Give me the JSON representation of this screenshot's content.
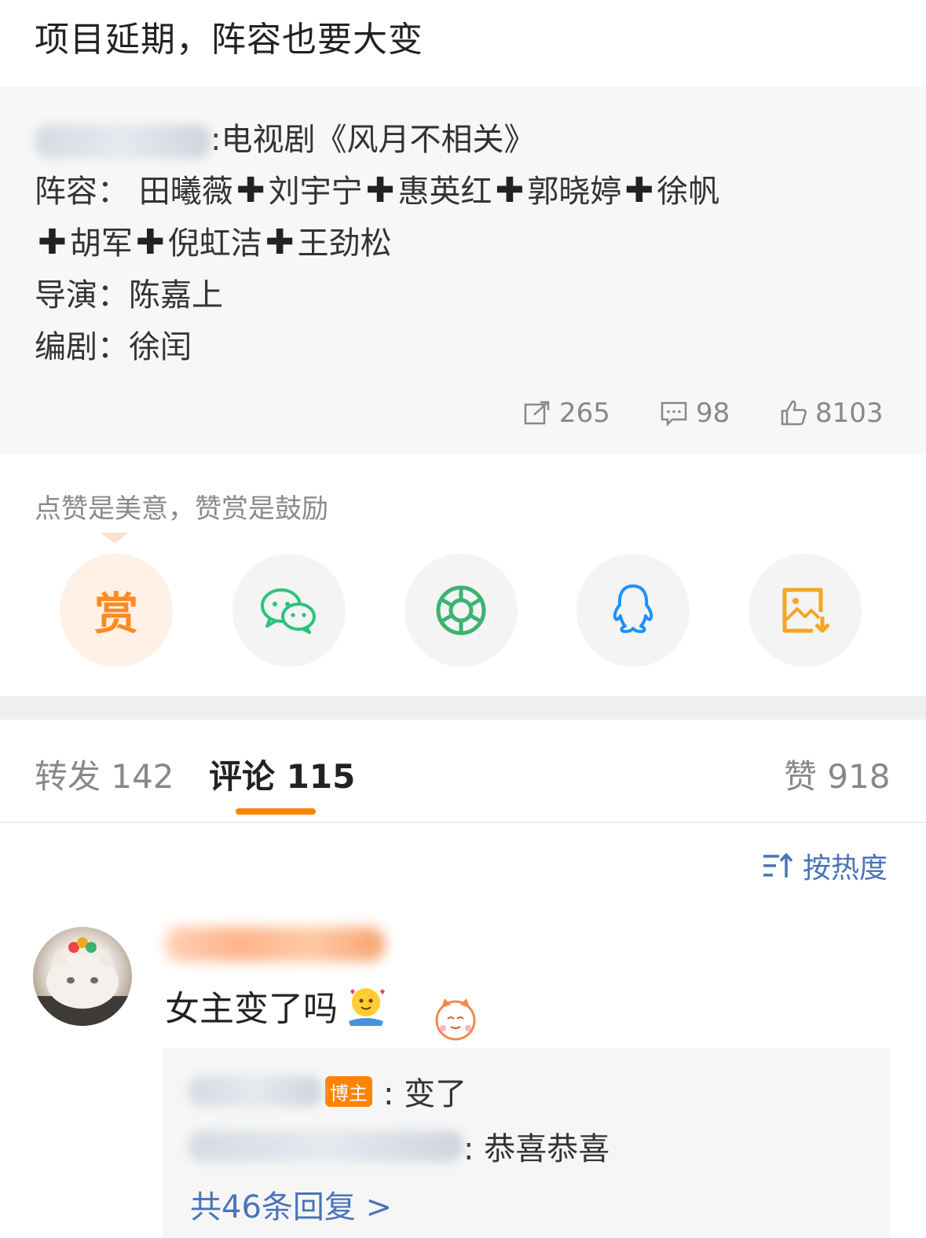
{
  "post": {
    "title": "项目延期，阵容也要大变"
  },
  "repost": {
    "line1_suffix": ":电视剧《风月不相关》",
    "cast_label": "阵容：",
    "cast_row1": [
      "田曦薇",
      "刘宇宁",
      "惠英红",
      "郭晓婷",
      "徐帆"
    ],
    "cast_row2": [
      "胡军",
      "倪虹洁",
      "王劲松"
    ],
    "director_label": "导演：",
    "director": "陈嘉上",
    "writer_label": "编剧：",
    "writer": "徐闰",
    "stats": {
      "reposts": "265",
      "comments": "98",
      "likes": "8103"
    }
  },
  "reward": {
    "tip": "点赞是美意，赞赏是鼓励",
    "reward_label": "赏",
    "share_icons": [
      "wechat-icon",
      "moments-icon",
      "qq-icon",
      "save-image-icon"
    ]
  },
  "tabs": {
    "repost": "转发 142",
    "comment": "评论 115",
    "like": "赞 918"
  },
  "sort": {
    "label": "按热度"
  },
  "comment": {
    "text": "女主变了吗",
    "replies": [
      {
        "badge": "博主",
        "text": ": 变了"
      },
      {
        "text": ": 恭喜恭喜"
      }
    ],
    "more": "共46条回复 >"
  },
  "colors": {
    "accent": "#ff8200",
    "link": "#4a74b8",
    "wechat": "#2dc27c",
    "moments": "#3cb371",
    "qq": "#1e90ff",
    "save": "#f5a623"
  }
}
